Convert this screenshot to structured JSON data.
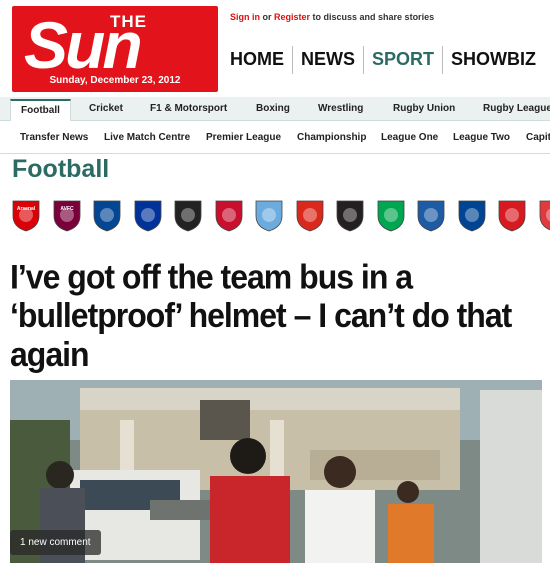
{
  "header": {
    "logo_the": "THE",
    "logo_sun": "Sun",
    "date": "Sunday, December 23, 2012",
    "signin_link": "Sign in",
    "signin_or": " or ",
    "register_link": "Register",
    "signin_suffix": " to discuss and share stories"
  },
  "main_nav": [
    "HOME",
    "NEWS",
    "SPORT",
    "SHOWBIZ"
  ],
  "sport_tabs": [
    "Football",
    "Cricket",
    "F1 & Motorsport",
    "Boxing",
    "Wrestling",
    "Rugby Union",
    "Rugby League"
  ],
  "sub_nav": [
    "Transfer News",
    "Live Match Centre",
    "Premier League",
    "Championship",
    "League One",
    "League Two",
    "Capit"
  ],
  "section_title": "Football",
  "clubs": [
    {
      "name": "arsenal-badge",
      "label": "Arsenal",
      "color": "#db0007"
    },
    {
      "name": "aston-villa-badge",
      "label": "AVFC",
      "color": "#7a003c"
    },
    {
      "name": "chelsea-badge",
      "label": "",
      "color": "#034694"
    },
    {
      "name": "everton-badge",
      "label": "",
      "color": "#003399"
    },
    {
      "name": "fulham-badge",
      "label": "",
      "color": "#222222"
    },
    {
      "name": "liverpool-badge",
      "label": "",
      "color": "#c8102e"
    },
    {
      "name": "man-city-badge",
      "label": "",
      "color": "#6cabdd"
    },
    {
      "name": "man-utd-badge",
      "label": "",
      "color": "#da291c"
    },
    {
      "name": "newcastle-badge",
      "label": "",
      "color": "#241f20"
    },
    {
      "name": "norwich-badge",
      "label": "",
      "color": "#00a650"
    },
    {
      "name": "qpr-badge",
      "label": "",
      "color": "#1d5ba4"
    },
    {
      "name": "reading-badge",
      "label": "",
      "color": "#004494"
    },
    {
      "name": "southampton-badge",
      "label": "",
      "color": "#d71920"
    },
    {
      "name": "stoke-badge",
      "label": "",
      "color": "#e03a3e"
    }
  ],
  "article": {
    "headline": "I’ve got off the team bus in a ‘bulletproof’ helmet – I can’t do that again",
    "comments": "1 new comment"
  },
  "colors": {
    "brand_red": "#e3131b",
    "sport_green": "#2b6b63"
  }
}
